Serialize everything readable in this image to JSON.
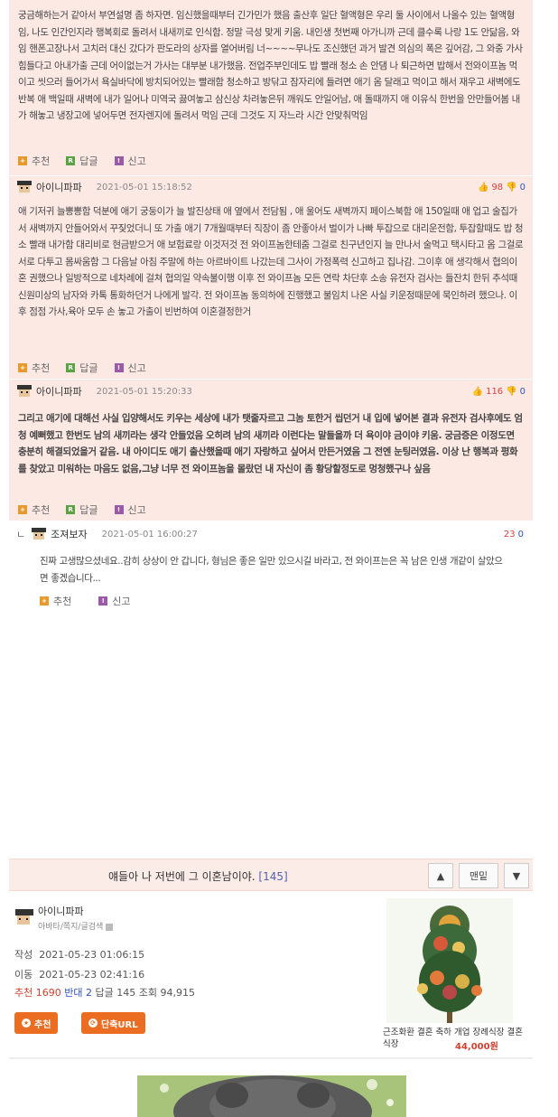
{
  "comment1": {
    "text": "궁금해하는거 같아서 부연설명 좀 하자면. 임신했을때부터 긴가민가 했음 출산후 일단 혈액형은 우리 둘 사이에서 나올수 있는 혈액형임, 나도 인간인지라 행복회로 돌려서 내새끼로 인식함. 정말 극성 맞게 키움. 내인생 첫번째 아가니까 근데 클수록 나랑 1도 안닮음, 와임 핸폰고장나서 고치러 대신 갔다가 판도라의 상자를 열어버림 너~~~~무나도 조신했던 과거 발견 의심의 폭은 깊어감, 그 와중 가사힘들다고 아내가출 근데 어이없는거 가사는 대부분 내가했음. 전업주부인데도 밥 빨래 청소 손 안댐 나 퇴근하면 밥해서 전와이프놈 먹이고 씻으러 들어가서 욕실바닥에 방치되어있는 빨래함 청소하고 방닦고 잠자리에 들려면 애기 옴 달래고 먹이고 해서 재우고 새벽에도 반복 애 백일때 새벽에 내가 일어나 미역국 끓여놓고 삼신상 차려놓은뒤 깨워도 안일어남, 애 돌때까지 애 이유식 한번을 안만들어봄 내가 해놓고 냉장고에 넣어두면 전자렌지에 돌려서 먹임 근데 그것도 지 자느라 시간 안맞춰먹임"
  },
  "actions": {
    "recommend": "추천",
    "reply": "답글",
    "report": "신고"
  },
  "comment2": {
    "author": "아이니파파",
    "date": "2021-05-01 15:18:52",
    "up": "98",
    "down": "0",
    "text": "애 기저귀 늘뽕뽕함 덕분에 애기 궁둥이가 늘 발진상태 애 옆에서 전담됨 , 애 울어도 새벽까지 페이스북함 애 150일때 애 업고 술집가서 새벽까지 안들어와서 꾸짖었더니 또 가출 애기 7개월때부터 직장이 좀 안좋아서 벌이가 나빠 투잡으로 대리운전함, 투잡할때도 밥 청소 빨래 내가함 대리비로 현금받으거 애 보험료랑 이것저것 전 와이프놈한테줌 그걸로 친구년인지 늘 만나서 술먹고 택시타고 옴 그걸로 서로 다투고 몸싸움함 그 다음날 아침 주말에 하는 아르바이트 나갔는데 그사이 가정폭력 신고하고 집나감. 그이후 애 생각해서 협의이혼 권했으나 일방적으로 네차례에 걸쳐 협의일 약속불이행 이후 전 와이프놈 모든 연락 차단후 소송 유전자 검사는 들잔치 한뒤 추석때 신원미상의 남자와 카톡 통화하던거 나에게 발각. 전 와이프놈 동의하에 진행했고 불임치 나온 사실 키운정때문에 묵인하려 했으나. 이후 점점 가사,육아 모두 손 놓고 가출이 빈번하여 이혼결정한거"
  },
  "comment3": {
    "author": "아이니파파",
    "date": "2021-05-01 15:20:33",
    "up": "116",
    "down": "0",
    "text": "그리고 애기에 대해선 사실 입양해서도 키우는 세상에 내가 탯줄자르고 그놈 토한거 씹던거 내 입에 넣어본 결과 유전자 검사후에도 엄청 예뻐했고 한번도 남의 새끼라는 생각 안들었음 오히려 남의 새끼라 이런다는 말들을까 더 욕이야 금이야 키움. 궁금증은 이정도면 충분히 해결되었을거 같음. 내 아이디도 애기 출산했을때 애기 자랑하고 싶어서 만든거였음 그 전엔 눈팅러였음. 이상 난 행복과 평화를 찾았고 미워하는 마음도 없음,그냥 너무 전 와이프놈을 몰랐던 내 자신이 좀 황당할정도로 멍청했구나 싶음"
  },
  "reply1": {
    "arrow": "ㄴ",
    "author": "조져보자",
    "date": "2021-05-01 16:00:27",
    "up": "23",
    "down": "0",
    "text": "진짜 고생많으셨네요..감히 상상이 안 갑니다, 형님은 좋은 일만 있으시길 바라고, 전 와이프는은 꼭 남은 인생 개같이 살았으면 좋겠습니다..."
  },
  "post_bar": {
    "title": "얘들아 나 저번에 그 이혼남이야.",
    "count": "[145]",
    "up_icon": "▲",
    "top_label": "맨밑",
    "down_icon": "▼"
  },
  "author_box": {
    "name": "아이니파파",
    "links": "아바타/쪽지/글검색",
    "created_label": "작성",
    "created": "2021-05-23 01:06:15",
    "moved_label": "이동",
    "moved": "2021-05-23 02:41:16",
    "stats": {
      "rec_label": "추천",
      "rec": "1690",
      "opp_label": "반대",
      "opp": "2",
      "reply_label": "답글",
      "reply": "145",
      "view_label": "조회",
      "view": "94,915"
    },
    "btn_recommend": "추천",
    "btn_short_url": "단축URL"
  },
  "ad": {
    "title": "근조화환 결혼 축하 개업 장례식장 결혼식장",
    "price": "44,000원"
  }
}
